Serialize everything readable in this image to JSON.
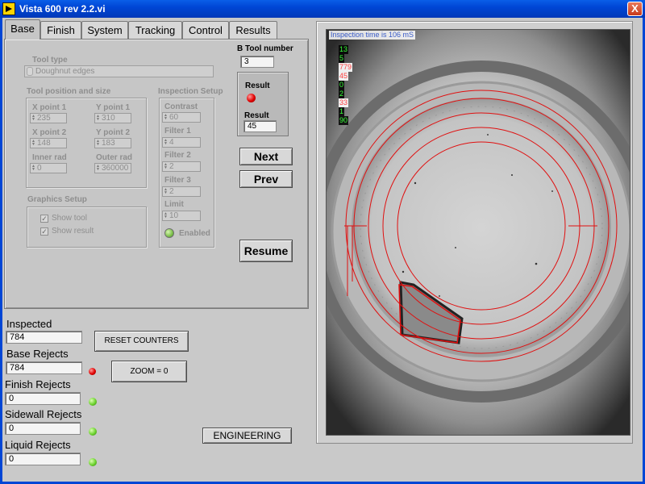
{
  "window": {
    "title": "Vista 600 rev 2.2.vi",
    "close_symbol": "X"
  },
  "tabs": [
    "Base",
    "Finish",
    "System",
    "Tracking",
    "Control",
    "Results"
  ],
  "active_tab": "Base",
  "tool_type": {
    "label": "Tool type",
    "value": "Doughnut edges"
  },
  "tool_position": {
    "title": "Tool position and size",
    "x1": {
      "label": "X point 1",
      "value": "235"
    },
    "y1": {
      "label": "Y point 1",
      "value": "310"
    },
    "x2": {
      "label": "X point 2",
      "value": "148"
    },
    "y2": {
      "label": "Y point 2",
      "value": "183"
    },
    "inner": {
      "label": "Inner rad",
      "value": "0"
    },
    "outer": {
      "label": "Outer rad",
      "value": "360000"
    }
  },
  "inspection_setup": {
    "title": "Inspection Setup",
    "contrast": {
      "label": "Contrast",
      "value": "60"
    },
    "filter1": {
      "label": "Filter 1",
      "value": "4"
    },
    "filter2": {
      "label": "Filter 2",
      "value": "2"
    },
    "filter3": {
      "label": "Filter 3",
      "value": "2"
    },
    "limit": {
      "label": "Limit",
      "value": "10"
    },
    "enabled_label": "Enabled"
  },
  "graphics_setup": {
    "title": "Graphics Setup",
    "show_tool": "Show tool",
    "show_result": "Show result",
    "check_mark": "✓"
  },
  "b_tool": {
    "label": "B Tool number",
    "value": "3"
  },
  "result": {
    "led_label": "Result",
    "value_label": "Result",
    "value": "45"
  },
  "buttons": {
    "next": "Next",
    "prev": "Prev",
    "resume": "Resume",
    "reset": "RESET COUNTERS",
    "zoom": "ZOOM = 0",
    "engineering": "ENGINEERING"
  },
  "counters": [
    {
      "label": "Inspected",
      "value": "784"
    },
    {
      "label": "Base Rejects",
      "value": "784",
      "led": "red"
    },
    {
      "label": "Finish Rejects",
      "value": "0",
      "led": "green"
    },
    {
      "label": "Sidewall Rejects",
      "value": "0",
      "led": "green"
    },
    {
      "label": "Liquid Rejects",
      "value": "0",
      "led": "green"
    }
  ],
  "image": {
    "inspection_time": "Inspection time is 106 mS",
    "overlay_values": [
      {
        "text": "13",
        "color": "#39ff39"
      },
      {
        "text": "5",
        "color": "#39ff39"
      },
      {
        "text": "779",
        "color": "#ff4040"
      },
      {
        "text": "45",
        "color": "#ff4040"
      },
      {
        "text": "0",
        "color": "#39ff39"
      },
      {
        "text": "2",
        "color": "#39ff39"
      },
      {
        "text": "33",
        "color": "#ff4040"
      },
      {
        "text": "1",
        "color": "#39ff39"
      },
      {
        "text": "90",
        "color": "#39ff39"
      }
    ],
    "overlay_color": "#e01010"
  }
}
